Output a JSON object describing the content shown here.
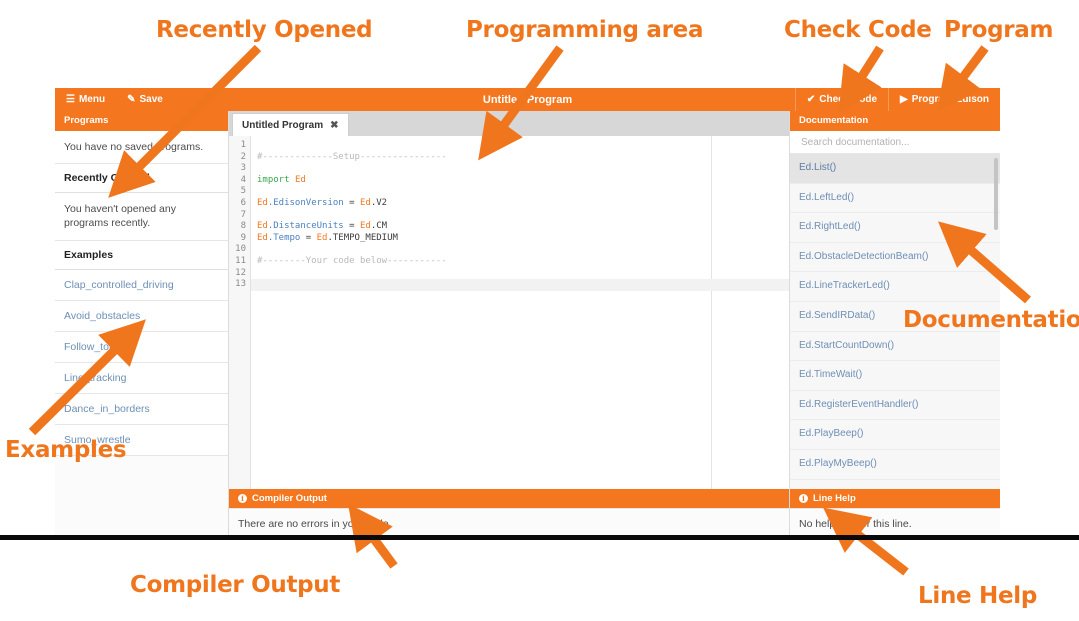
{
  "annotations": [
    {
      "id": "recently-opened",
      "label": "Recently Opened"
    },
    {
      "id": "programming-area",
      "label": "Programming area"
    },
    {
      "id": "check-code",
      "label": "Check Code"
    },
    {
      "id": "program",
      "label": "Program"
    },
    {
      "id": "documentation",
      "label": "Documentation"
    },
    {
      "id": "examples",
      "label": "Examples"
    },
    {
      "id": "compiler-output",
      "label": "Compiler Output"
    },
    {
      "id": "line-help",
      "label": "Line Help"
    }
  ],
  "colors": {
    "accent": "#F4771F",
    "annotation": "#F0761E",
    "link": "#6e8fb5",
    "code_keyword": "#37a84a",
    "code_comment": "#b9b9b9"
  },
  "topbar": {
    "menu_label": "Menu",
    "menu_icon": "hamburger-icon",
    "save_label": "Save",
    "save_icon": "pencil-icon",
    "title": "Untitled Program",
    "check_code_label": "Check Code",
    "check_code_icon": "check-icon",
    "program_label": "Program Edison",
    "program_icon": "play-icon"
  },
  "sidebar": {
    "header": "Programs",
    "saved_note": "You have no saved programs.",
    "recently_opened_heading": "Recently Opened",
    "recently_opened_note": "You haven't opened any programs recently.",
    "examples_heading": "Examples",
    "examples": [
      "Clap_controlled_driving",
      "Avoid_obstacles",
      "Follow_torch",
      "Line_tracking",
      "Dance_in_borders",
      "Sumo_wrestle"
    ]
  },
  "editor": {
    "tab_label": "Untitled Program",
    "tab_close_icon": "close-icon",
    "line_numbers": [
      "1",
      "2",
      "3",
      "4",
      "5",
      "6",
      "7",
      "8",
      "9",
      "10",
      "11",
      "12",
      "13"
    ],
    "lines": [
      {
        "n": 1,
        "tokens": []
      },
      {
        "n": 2,
        "tokens": [
          {
            "t": "#-------------Setup----------------",
            "c": "cmt"
          }
        ]
      },
      {
        "n": 3,
        "tokens": []
      },
      {
        "n": 4,
        "tokens": [
          {
            "t": "import ",
            "c": "kw"
          },
          {
            "t": "Ed",
            "c": "ed"
          }
        ]
      },
      {
        "n": 5,
        "tokens": []
      },
      {
        "n": 6,
        "tokens": [
          {
            "t": "Ed",
            "c": "ed"
          },
          {
            "t": ".EdisonVersion ",
            "c": "cls"
          },
          {
            "t": "= ",
            "c": "pl"
          },
          {
            "t": "Ed",
            "c": "ed"
          },
          {
            "t": ".V2",
            "c": "pl"
          }
        ]
      },
      {
        "n": 7,
        "tokens": []
      },
      {
        "n": 8,
        "tokens": [
          {
            "t": "Ed",
            "c": "ed"
          },
          {
            "t": ".DistanceUnits ",
            "c": "cls"
          },
          {
            "t": "= ",
            "c": "pl"
          },
          {
            "t": "Ed",
            "c": "ed"
          },
          {
            "t": ".CM",
            "c": "pl"
          }
        ]
      },
      {
        "n": 9,
        "tokens": [
          {
            "t": "Ed",
            "c": "ed"
          },
          {
            "t": ".Tempo ",
            "c": "cls"
          },
          {
            "t": "= ",
            "c": "pl"
          },
          {
            "t": "Ed",
            "c": "ed"
          },
          {
            "t": ".TEMPO_MEDIUM",
            "c": "pl"
          }
        ]
      },
      {
        "n": 10,
        "tokens": []
      },
      {
        "n": 11,
        "tokens": [
          {
            "t": "#--------Your code below-----------",
            "c": "cmt"
          }
        ]
      },
      {
        "n": 12,
        "tokens": []
      },
      {
        "n": 13,
        "tokens": []
      }
    ]
  },
  "compiler_output": {
    "header": "Compiler Output",
    "header_icon": "info-icon",
    "message": "There are no errors in your code."
  },
  "documentation": {
    "header": "Documentation",
    "search_placeholder": "Search documentation...",
    "search_value": "",
    "items": [
      "Ed.List()",
      "Ed.LeftLed()",
      "Ed.RightLed()",
      "Ed.ObstacleDetectionBeam()",
      "Ed.LineTrackerLed()",
      "Ed.SendIRData()",
      "Ed.StartCountDown()",
      "Ed.TimeWait()",
      "Ed.RegisterEventHandler()",
      "Ed.PlayBeep()",
      "Ed.PlayMyBeep()"
    ],
    "selected_index": 0
  },
  "line_help": {
    "header": "Line Help",
    "header_icon": "info-icon",
    "message": "No help text for this line."
  }
}
